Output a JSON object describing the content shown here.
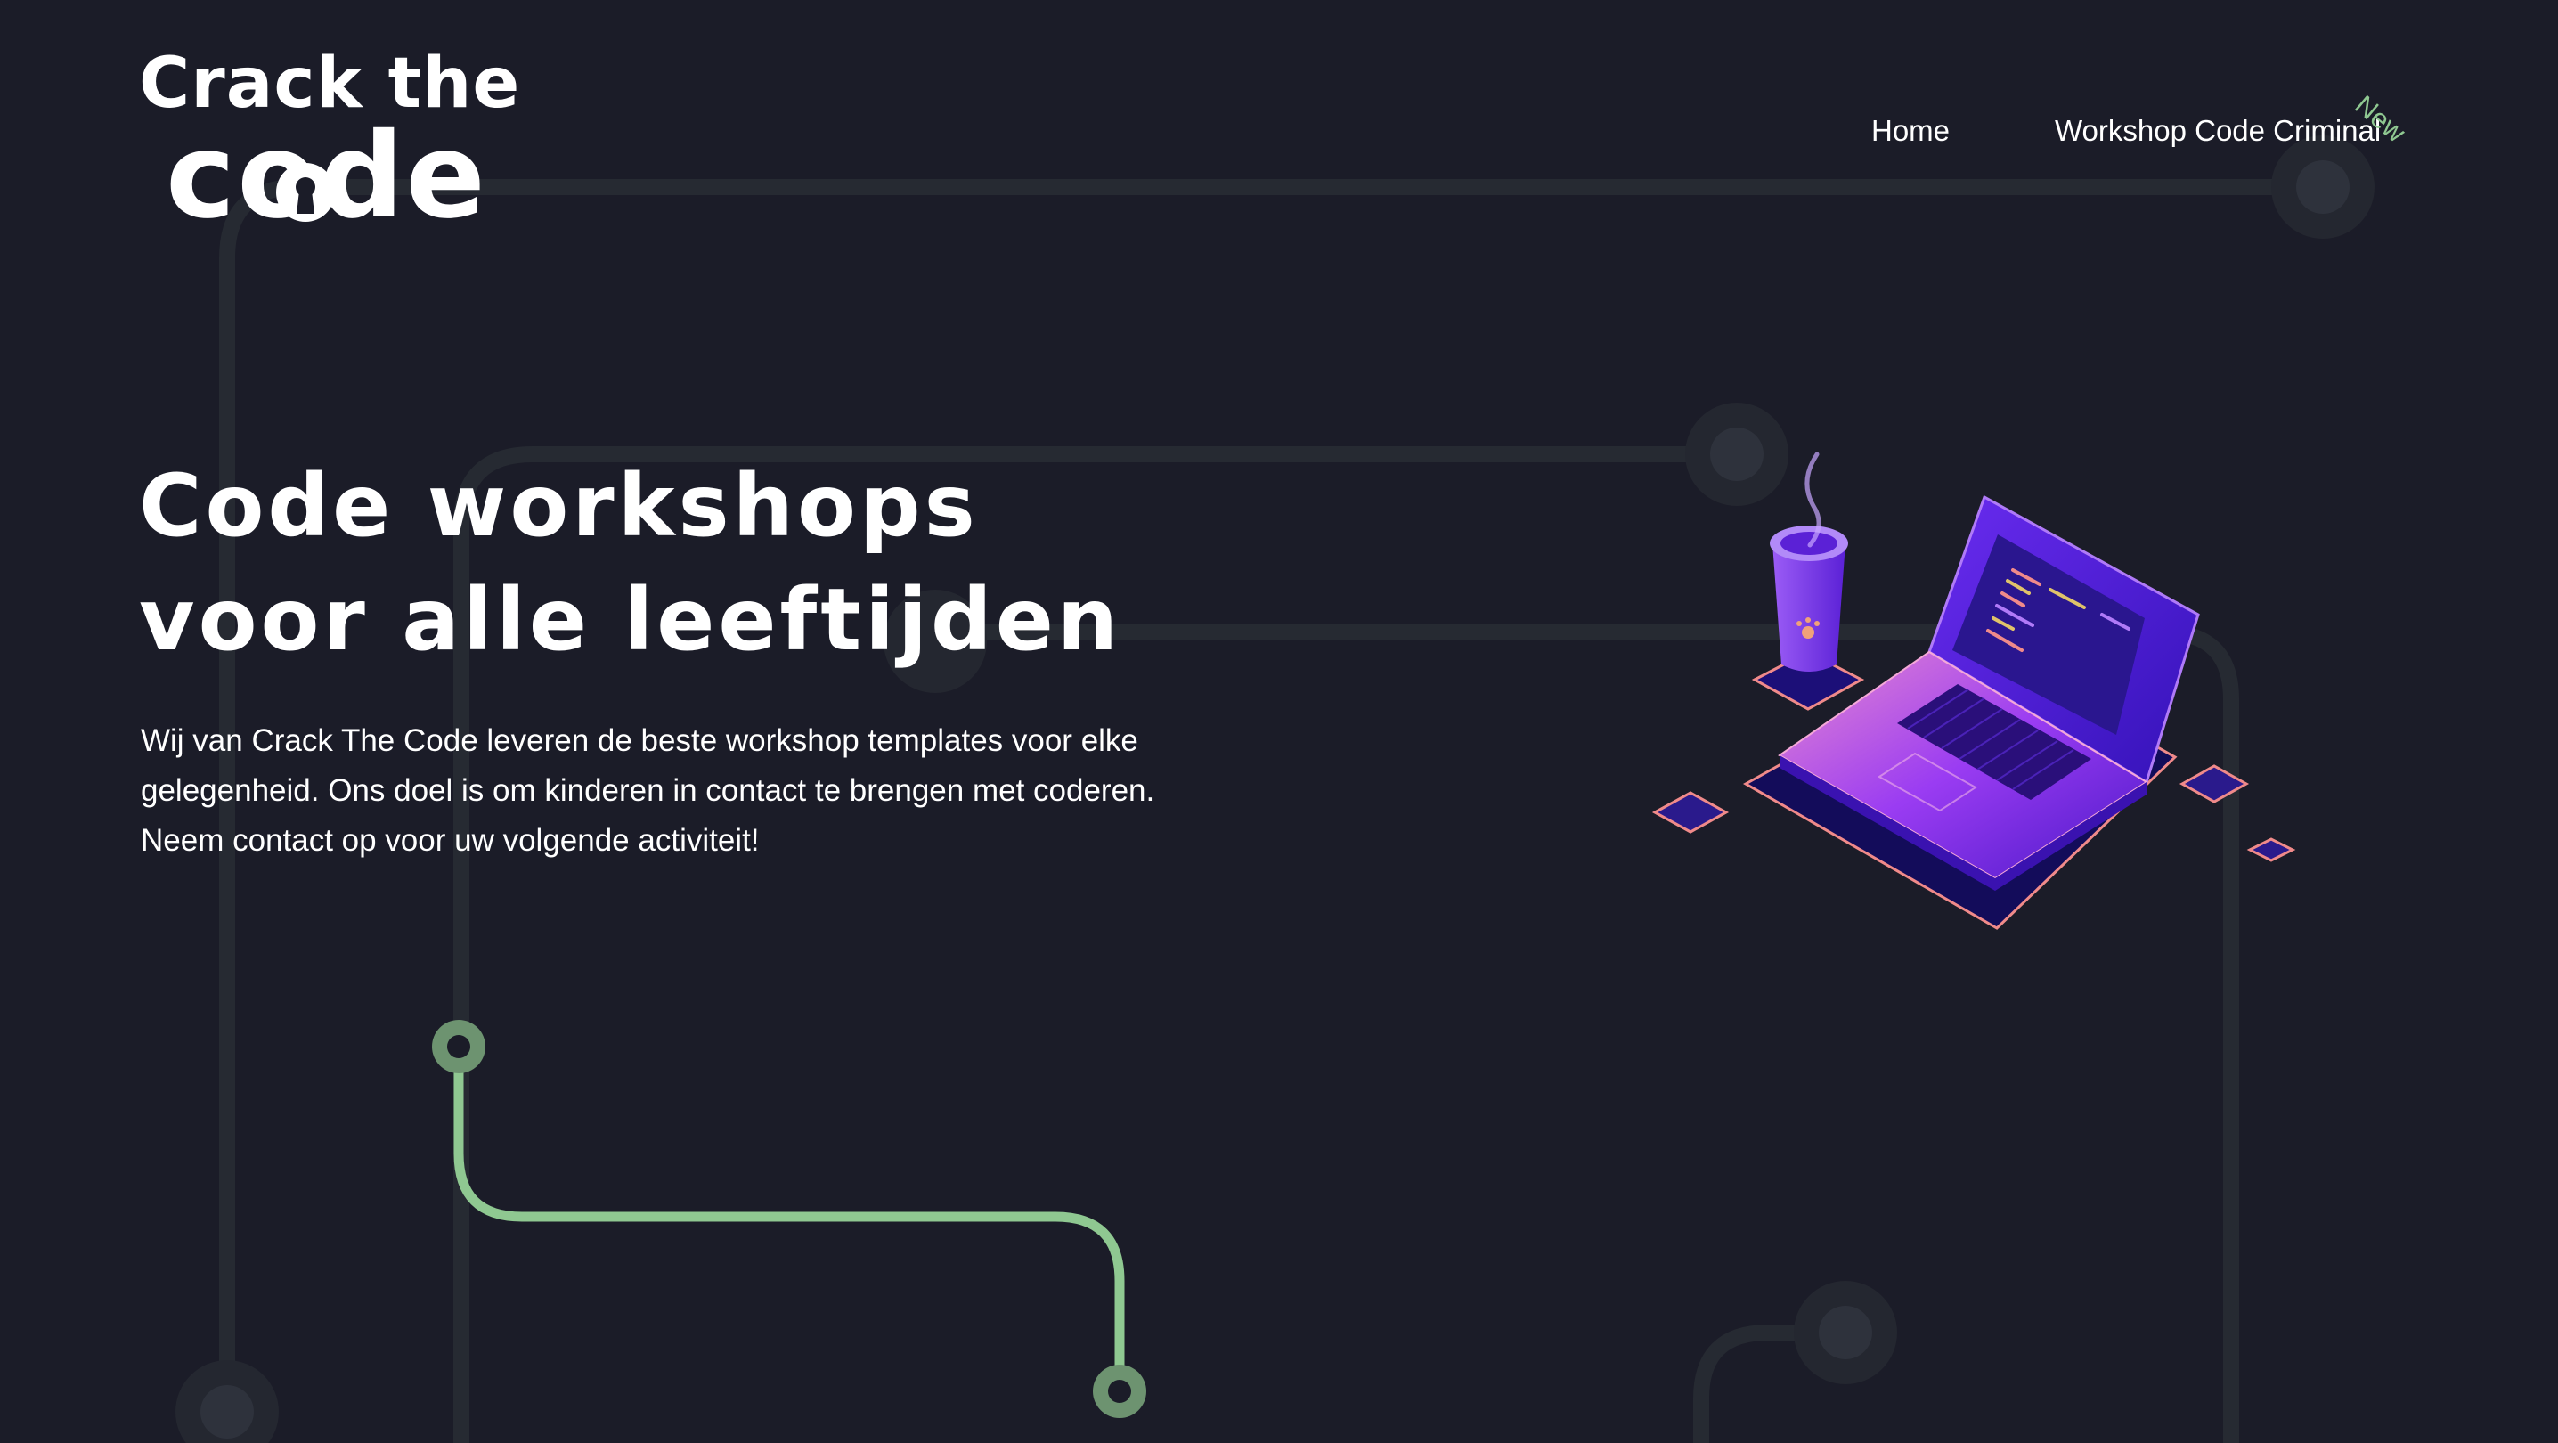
{
  "logo": {
    "line1": "Crack the",
    "line2": "code"
  },
  "nav": {
    "items": [
      {
        "label": "Home"
      },
      {
        "label": "Workshop Code Criminal"
      }
    ],
    "badge": "New"
  },
  "hero": {
    "title_line1": "Code workshops",
    "title_line2": "voor alle leeftijden",
    "intro": "Wij van Crack The Code leveren de beste workshop templates voor elke gelegenheid. Ons doel is om kinderen in contact te brengen met coderen. Neem contact op voor uw volgende activiteit!"
  },
  "colors": {
    "background": "#1b1c28",
    "circuit_line": "#2b2f36",
    "accent_green": "#8fc891",
    "accent_purple": "#7b2ff7",
    "accent_pink": "#f08a8a"
  },
  "icons": [
    "keyhole-icon",
    "laptop-illustration",
    "coffee-cup-illustration"
  ]
}
